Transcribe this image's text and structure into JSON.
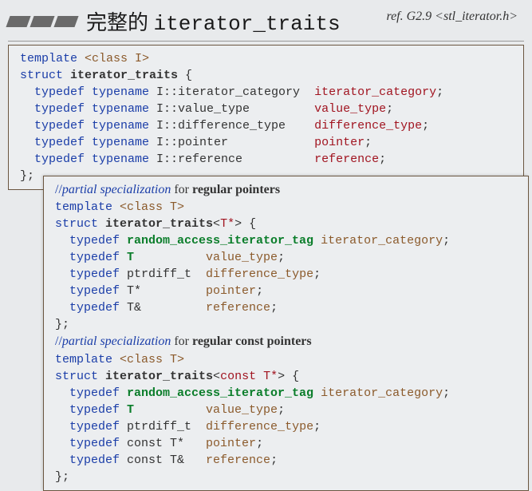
{
  "header": {
    "title_prefix": "完整的 ",
    "title_code": "iterator_traits",
    "ref_label": "ref. G2.9  ",
    "ref_file": "<stl_iterator.h>"
  },
  "box1": {
    "l1_a": "template ",
    "l1_b": "<class I>",
    "l2_a": "struct ",
    "l2_b": "iterator_traits",
    "l2_c": " {",
    "l3_a": "  typedef typename ",
    "l3_b": "I::iterator_category",
    "l3_c": "  ",
    "l3_d": "iterator_category",
    "l3_e": ";",
    "l4_a": "  typedef typename ",
    "l4_b": "I::value_type",
    "l4_c": "         ",
    "l4_d": "value_type",
    "l4_e": ";",
    "l5_a": "  typedef typename ",
    "l5_b": "I::difference_type",
    "l5_c": "    ",
    "l5_d": "difference_type",
    "l5_e": ";",
    "l6_a": "  typedef typename ",
    "l6_b": "I::pointer",
    "l6_c": "            ",
    "l6_d": "pointer",
    "l6_e": ";",
    "l7_a": "  typedef typename ",
    "l7_b": "I::reference",
    "l7_c": "          ",
    "l7_d": "reference",
    "l7_e": ";",
    "l8": "};"
  },
  "box2": {
    "c1_a": "//",
    "c1_b": "partial specialization",
    "c1_c": " for ",
    "c1_d": "regular pointers",
    "s1_l1_a": "template ",
    "s1_l1_b": "<class T>",
    "s1_l2_a": "struct ",
    "s1_l2_b": "iterator_traits",
    "s1_l2_c": "<",
    "s1_l2_d": "T*",
    "s1_l2_e": ">",
    "s1_l2_f": " {",
    "s1_l3_a": "  typedef ",
    "s1_l3_b": "random_access_iterator_tag",
    "s1_l3_c": " ",
    "s1_l3_d": "iterator_category",
    "s1_l3_e": ";",
    "s1_l4_a": "  typedef ",
    "s1_l4_b": "T",
    "s1_l4_c": "          ",
    "s1_l4_d": "value_type",
    "s1_l4_e": ";",
    "s1_l5_a": "  typedef ",
    "s1_l5_b": "ptrdiff_t",
    "s1_l5_c": "  ",
    "s1_l5_d": "difference_type",
    "s1_l5_e": ";",
    "s1_l6_a": "  typedef ",
    "s1_l6_b": "T*",
    "s1_l6_c": "         ",
    "s1_l6_d": "pointer",
    "s1_l6_e": ";",
    "s1_l7_a": "  typedef ",
    "s1_l7_b": "T&",
    "s1_l7_c": "         ",
    "s1_l7_d": "reference",
    "s1_l7_e": ";",
    "s1_l8": "};",
    "c2_a": "//",
    "c2_b": "partial specialization",
    "c2_c": " for ",
    "c2_d": "regular const pointers",
    "s2_l1_a": "template ",
    "s2_l1_b": "<class T>",
    "s2_l2_a": "struct ",
    "s2_l2_b": "iterator_traits",
    "s2_l2_c": "<",
    "s2_l2_d": "const T*",
    "s2_l2_e": ">",
    "s2_l2_f": " {",
    "s2_l3_a": "  typedef ",
    "s2_l3_b": "random_access_iterator_tag",
    "s2_l3_c": " ",
    "s2_l3_d": "iterator_category",
    "s2_l3_e": ";",
    "s2_l4_a": "  typedef ",
    "s2_l4_b": "T",
    "s2_l4_c": "          ",
    "s2_l4_d": "value_type",
    "s2_l4_e": ";",
    "s2_l5_a": "  typedef ",
    "s2_l5_b": "ptrdiff_t",
    "s2_l5_c": "  ",
    "s2_l5_d": "difference_type",
    "s2_l5_e": ";",
    "s2_l6_a": "  typedef ",
    "s2_l6_b": "const T*",
    "s2_l6_c": "   ",
    "s2_l6_d": "pointer",
    "s2_l6_e": ";",
    "s2_l7_a": "  typedef ",
    "s2_l7_b": "const T&",
    "s2_l7_c": "   ",
    "s2_l7_d": "reference",
    "s2_l7_e": ";",
    "s2_l8": "};"
  }
}
